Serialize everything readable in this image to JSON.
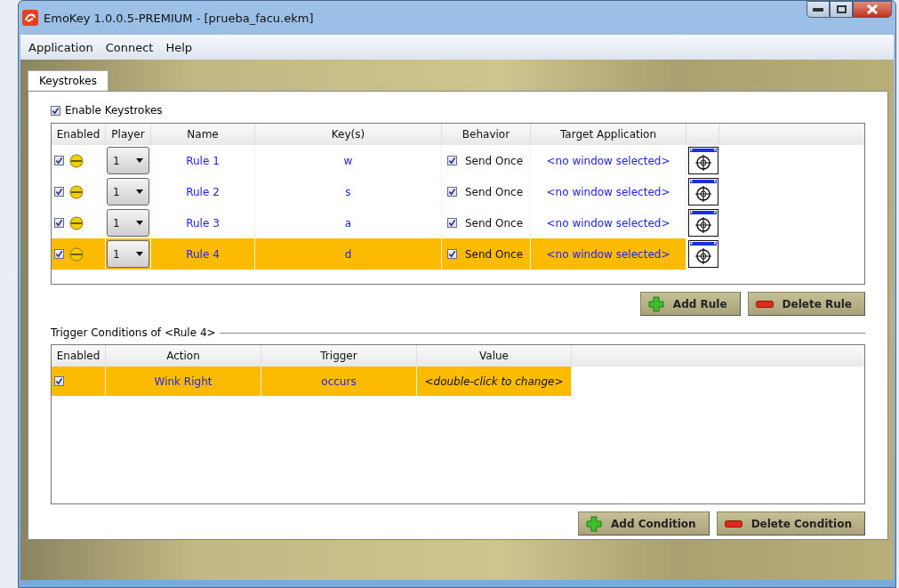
{
  "window": {
    "title": "EmoKey 1.0.0.5-PREMIUM - [prueba_facu.ekm]"
  },
  "menu": [
    "Application",
    "Connect",
    "Help"
  ],
  "tabs": [
    {
      "label": "Keystrokes",
      "selected": true
    }
  ],
  "enable_keystrokes": {
    "label": "Enable Keystrokes",
    "checked": true
  },
  "rules_table": {
    "columns": [
      "Enabled",
      "Player",
      "Name",
      "Key(s)",
      "Behavior",
      "Target Application"
    ],
    "rows": [
      {
        "enabled": true,
        "player": "1",
        "name": "Rule 1",
        "keys": "w",
        "behavior_checked": true,
        "behavior": "Send Once",
        "target": "<no window selected>",
        "selected": false
      },
      {
        "enabled": true,
        "player": "1",
        "name": "Rule 2",
        "keys": "s",
        "behavior_checked": true,
        "behavior": "Send Once",
        "target": "<no window selected>",
        "selected": false
      },
      {
        "enabled": true,
        "player": "1",
        "name": "Rule 3",
        "keys": "a",
        "behavior_checked": true,
        "behavior": "Send Once",
        "target": "<no window selected>",
        "selected": false
      },
      {
        "enabled": true,
        "player": "1",
        "name": "Rule 4",
        "keys": "d",
        "behavior_checked": true,
        "behavior": "Send Once",
        "target": "<no window selected>",
        "selected": true
      }
    ]
  },
  "rule_buttons": [
    "Add Rule",
    "Delete Rule"
  ],
  "conditions_title": "Trigger Conditions of <Rule 4>",
  "conditions_table": {
    "columns": [
      "Enabled",
      "Action",
      "Trigger",
      "Value"
    ],
    "rows": [
      {
        "enabled": true,
        "action": "Wink Right",
        "trigger": "occurs",
        "value": "<double-click to change>",
        "selected": true
      }
    ]
  },
  "condition_buttons": [
    "Add Condition",
    "Delete Condition"
  ]
}
